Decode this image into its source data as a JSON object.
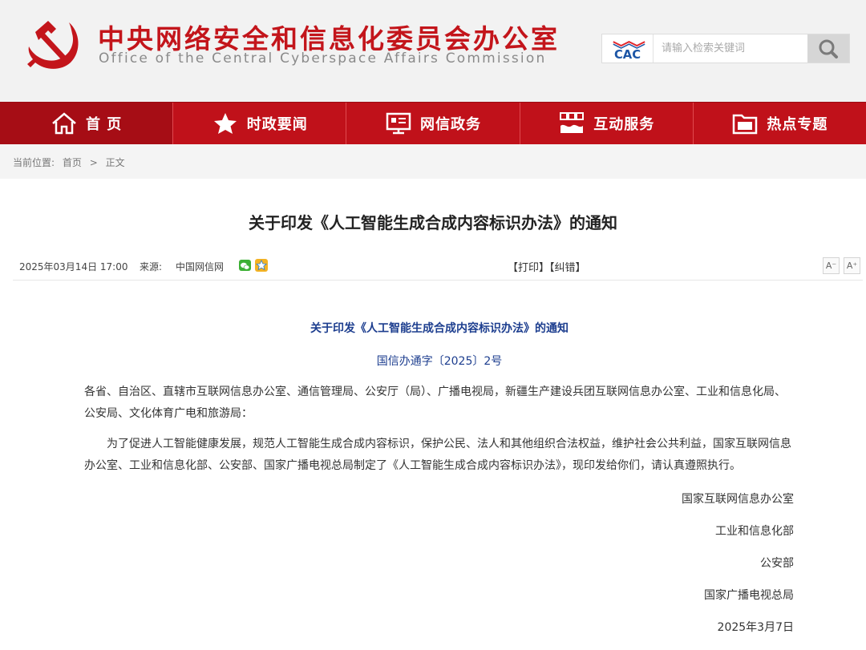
{
  "header": {
    "title": "中央网络安全和信息化委员会办公室",
    "subtitle": "Office of the Central Cyberspace Affairs Commission",
    "search_logo_text": "CAC",
    "search_placeholder": "请输入检索关键词"
  },
  "nav": {
    "items": [
      {
        "label": "首 页",
        "icon": "home-icon"
      },
      {
        "label": "时政要闻",
        "icon": "star-icon"
      },
      {
        "label": "网信政务",
        "icon": "monitor-icon"
      },
      {
        "label": "互动服务",
        "icon": "handshake-icon"
      },
      {
        "label": "热点专题",
        "icon": "folder-icon"
      }
    ]
  },
  "breadcrumb": {
    "label": "当前位置:",
    "home": "首页",
    "separator": ">",
    "current": "正文"
  },
  "article": {
    "title": "关于印发《人工智能生成合成内容标识办法》的通知",
    "date": "2025年03月14日 17:00",
    "source_label": "来源:",
    "source": "中国网信网",
    "actions": "【打印】【纠错】",
    "font_small": "A⁻",
    "font_large": "A⁺",
    "doc_title": "关于印发《人工智能生成合成内容标识办法》的通知",
    "doc_number": "国信办通字〔2025〕2号",
    "paragraph1": "各省、自治区、直辖市互联网信息办公室、通信管理局、公安厅（局）、广播电视局，新疆生产建设兵团互联网信息办公室、工业和信息化局、公安局、文化体育广电和旅游局：",
    "paragraph2": "为了促进人工智能健康发展，规范人工智能生成合成内容标识，保护公民、法人和其他组织合法权益，维护社会公共利益，国家互联网信息办公室、工业和信息化部、公安部、国家广播电视总局制定了《人工智能生成合成内容标识办法》，现印发给你们，请认真遵照执行。",
    "signatures": [
      "国家互联网信息办公室",
      "工业和信息化部",
      "公安部",
      "国家广播电视总局",
      "2025年3月7日"
    ]
  },
  "colors": {
    "brand_red": "#c0111a",
    "doc_blue": "#1d3e8f"
  }
}
